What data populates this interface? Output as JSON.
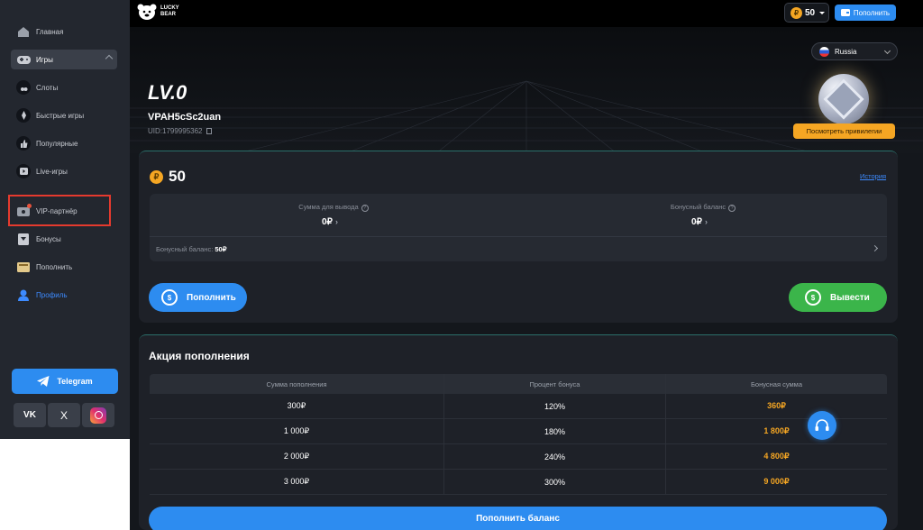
{
  "brand": {
    "line1": "LUCKY",
    "line2": "BEAR"
  },
  "header": {
    "balance": "50",
    "topup_label": "Пополнить",
    "coin_symbol": "₽"
  },
  "sidebar": {
    "items": [
      {
        "label": "Главная",
        "icon": "home-icon"
      },
      {
        "label": "Игры",
        "icon": "gamepad-icon"
      },
      {
        "label": "Слоты",
        "icon": "cherry-icon"
      },
      {
        "label": "Быстрые игры",
        "icon": "rocket-icon"
      },
      {
        "label": "Популярные",
        "icon": "thumbs-up-icon"
      },
      {
        "label": "Live-игры",
        "icon": "play-icon"
      },
      {
        "label": "VIP-партнёр",
        "icon": "partner-icon"
      },
      {
        "label": "Бонусы",
        "icon": "gift-icon"
      },
      {
        "label": "Пополнить",
        "icon": "wallet-icon"
      },
      {
        "label": "Профиль",
        "icon": "user-icon"
      }
    ],
    "telegram_label": "Telegram",
    "socials": [
      "VK",
      "X",
      "Instagram"
    ]
  },
  "language": {
    "selected": "Russia"
  },
  "profile": {
    "level": "LV.0",
    "username": "VPAH5cSc2uan",
    "uid": "UID:1799995362",
    "privileges_label": "Посмотреть привилегии"
  },
  "wallet": {
    "balance": "50",
    "history_label": "История",
    "withdraw_label": "Сумма для вывода",
    "withdraw_value": "0₽",
    "bonus_label": "Бонусный баланс",
    "bonus_value": "0₽",
    "bonus_line_label": "Бонусный баланс:",
    "bonus_line_value": "50₽",
    "deposit_button": "Пополнить",
    "withdraw_button": "Вывести"
  },
  "promo": {
    "title": "Акция пополнения",
    "columns": [
      "Сумма пополнения",
      "Процент бонуса",
      "Бонусная сумма"
    ],
    "rows": [
      [
        "300₽",
        "120%",
        "360₽"
      ],
      [
        "1 000₽",
        "180%",
        "1 800₽"
      ],
      [
        "2 000₽",
        "240%",
        "4 800₽"
      ],
      [
        "3 000₽",
        "300%",
        "9 000₽"
      ]
    ],
    "cta": "Пополнить баланс"
  },
  "colors": {
    "accent": "#2d8cf0",
    "gold": "#f5a623",
    "success": "#3bb54a",
    "highlight": "#e53a2e"
  }
}
